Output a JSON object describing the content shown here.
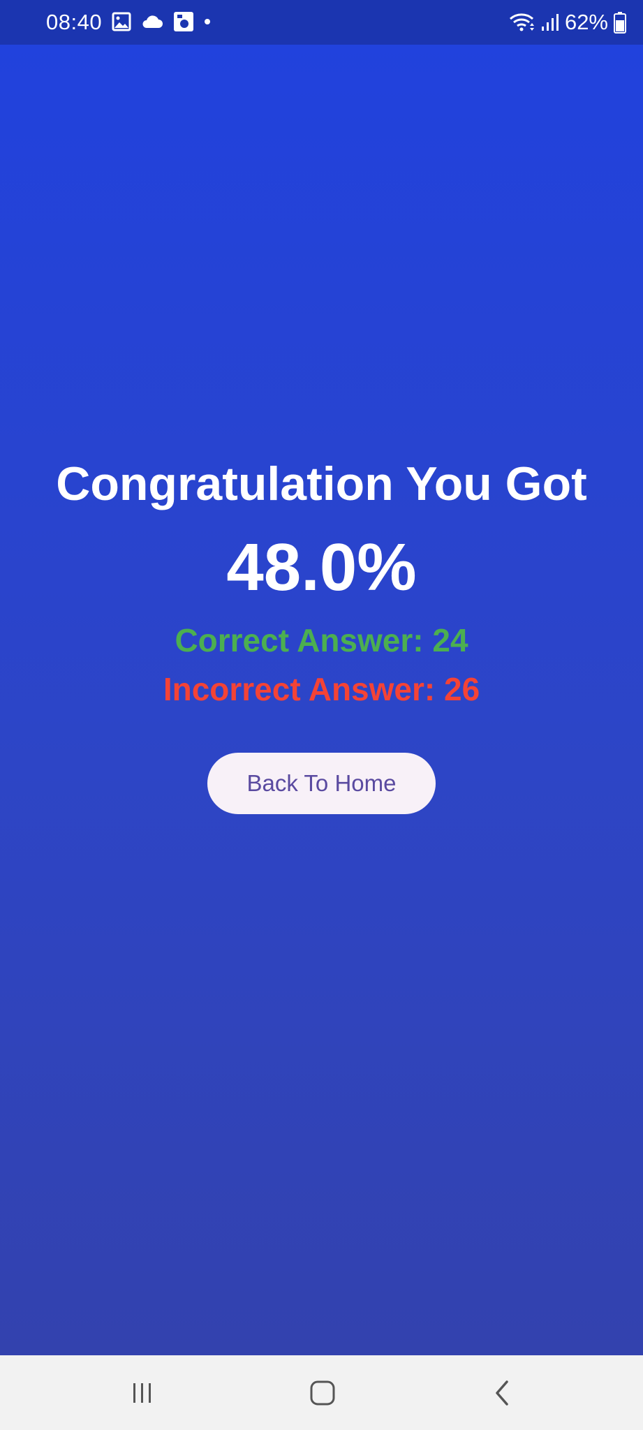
{
  "status_bar": {
    "time": "08:40",
    "battery": "62%",
    "left_icons": [
      "gallery-icon",
      "cloud-icon",
      "app-notification-icon",
      "dot-icon"
    ],
    "right_icons": [
      "wifi-icon",
      "signal-icon",
      "battery-icon"
    ]
  },
  "result": {
    "title": "Congratulation You Got",
    "score": "48.0%",
    "correct": "Correct Answer: 24",
    "incorrect": "Incorrect Answer: 26",
    "home_button_label": "Back To Home"
  },
  "colors": {
    "background_top": "#2142dd",
    "background_bottom": "#3342ae",
    "correct": "#4caf50",
    "incorrect": "#f44336",
    "button_bg": "#f8f1f8",
    "button_text": "#5a4aa0"
  },
  "nav_bar": {
    "buttons": [
      "recent-apps-icon",
      "home-icon",
      "back-icon"
    ]
  }
}
